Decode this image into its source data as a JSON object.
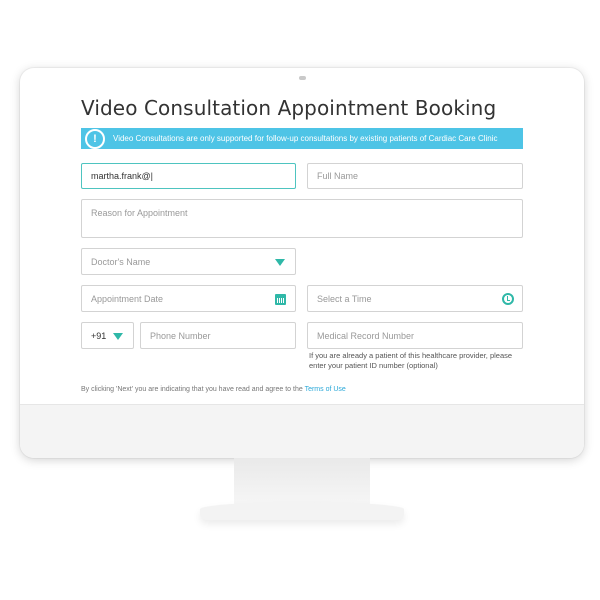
{
  "page": {
    "title": "Video Consultation Appointment Booking",
    "notice": {
      "icon": "exclamation-icon",
      "text": "Video Consultations are only supported for follow-up consultations by existing patients of Cardiac Care Clinic"
    }
  },
  "form": {
    "email": {
      "value": "martha.frank@|"
    },
    "full_name": {
      "placeholder": "Full Name"
    },
    "reason": {
      "placeholder": "Reason for Appointment"
    },
    "doctor": {
      "placeholder": "Doctor's Name"
    },
    "date": {
      "placeholder": "Appointment Date"
    },
    "time": {
      "placeholder": "Select a Time"
    },
    "country_code": {
      "value": "+91"
    },
    "phone": {
      "placeholder": "Phone Number"
    },
    "mrn": {
      "placeholder": "Medical Record Number"
    },
    "mrn_help": "If you are already a patient of this healthcare provider, please enter your patient ID number (optional)",
    "terms_prefix": "By clicking 'Next' you are indicating that you have read and agree to the ",
    "terms_link": "Terms of Use"
  },
  "colors": {
    "accent": "#4ec4e6",
    "teal": "#2fb8a8",
    "active_border": "#4ec4c0"
  }
}
